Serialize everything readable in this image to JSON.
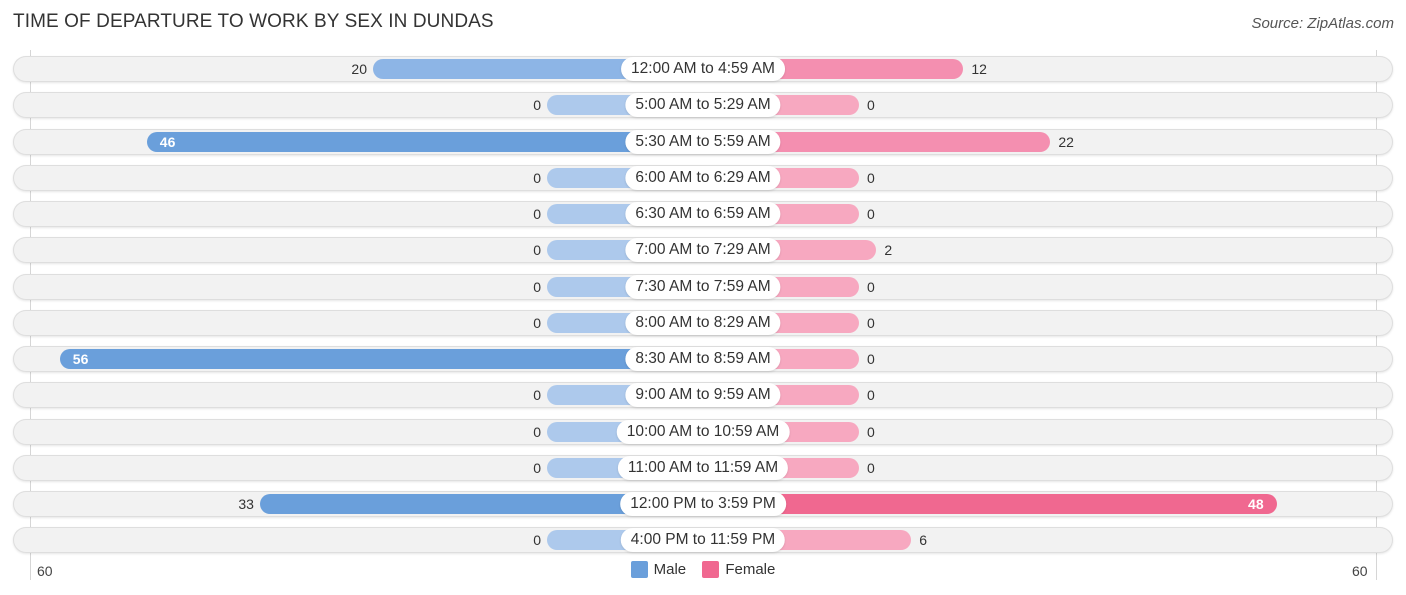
{
  "title": "TIME OF DEPARTURE TO WORK BY SEX IN DUNDAS",
  "source": "Source: ZipAtlas.com",
  "colors": {
    "male_strong": "#6a9fdb",
    "male_light": "#adc9ec",
    "female_strong": "#f06890",
    "female_light": "#f7a8c0"
  },
  "chart_data": {
    "type": "bar",
    "orientation": "horizontal-diverging",
    "title": "TIME OF DEPARTURE TO WORK BY SEX IN DUNDAS",
    "categories": [
      "12:00 AM to 4:59 AM",
      "5:00 AM to 5:29 AM",
      "5:30 AM to 5:59 AM",
      "6:00 AM to 6:29 AM",
      "6:30 AM to 6:59 AM",
      "7:00 AM to 7:29 AM",
      "7:30 AM to 7:59 AM",
      "8:00 AM to 8:29 AM",
      "8:30 AM to 8:59 AM",
      "9:00 AM to 9:59 AM",
      "10:00 AM to 10:59 AM",
      "11:00 AM to 11:59 AM",
      "12:00 PM to 3:59 PM",
      "4:00 PM to 11:59 PM"
    ],
    "series": [
      {
        "name": "Male",
        "values": [
          20,
          0,
          46,
          0,
          0,
          0,
          0,
          0,
          56,
          0,
          0,
          0,
          33,
          0
        ]
      },
      {
        "name": "Female",
        "values": [
          12,
          0,
          22,
          0,
          0,
          2,
          0,
          0,
          0,
          0,
          0,
          0,
          48,
          6
        ]
      }
    ],
    "axis": {
      "left_label": "60",
      "right_label": "60",
      "max": 60
    },
    "legend": {
      "position": "bottom-center",
      "entries": [
        "Male",
        "Female"
      ]
    }
  }
}
